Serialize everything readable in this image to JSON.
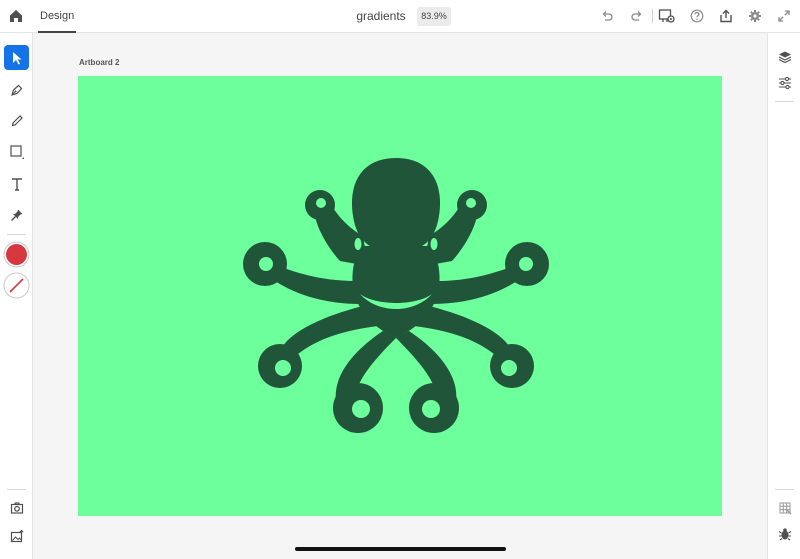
{
  "topbar": {
    "mode_tab": "Design",
    "document_title": "gradients",
    "zoom": "83.9%"
  },
  "canvas": {
    "artboard_label": "Artboard 2",
    "artboard_color": "#6dff9c",
    "artwork_color": "#21553a"
  },
  "tools": {
    "fill_color": "#d7373f",
    "active_tool": "select",
    "icons": [
      "select-icon",
      "pen-icon",
      "pencil-icon",
      "rectangle-icon",
      "text-icon",
      "pin-icon"
    ]
  },
  "accent_color": "#1473e6"
}
